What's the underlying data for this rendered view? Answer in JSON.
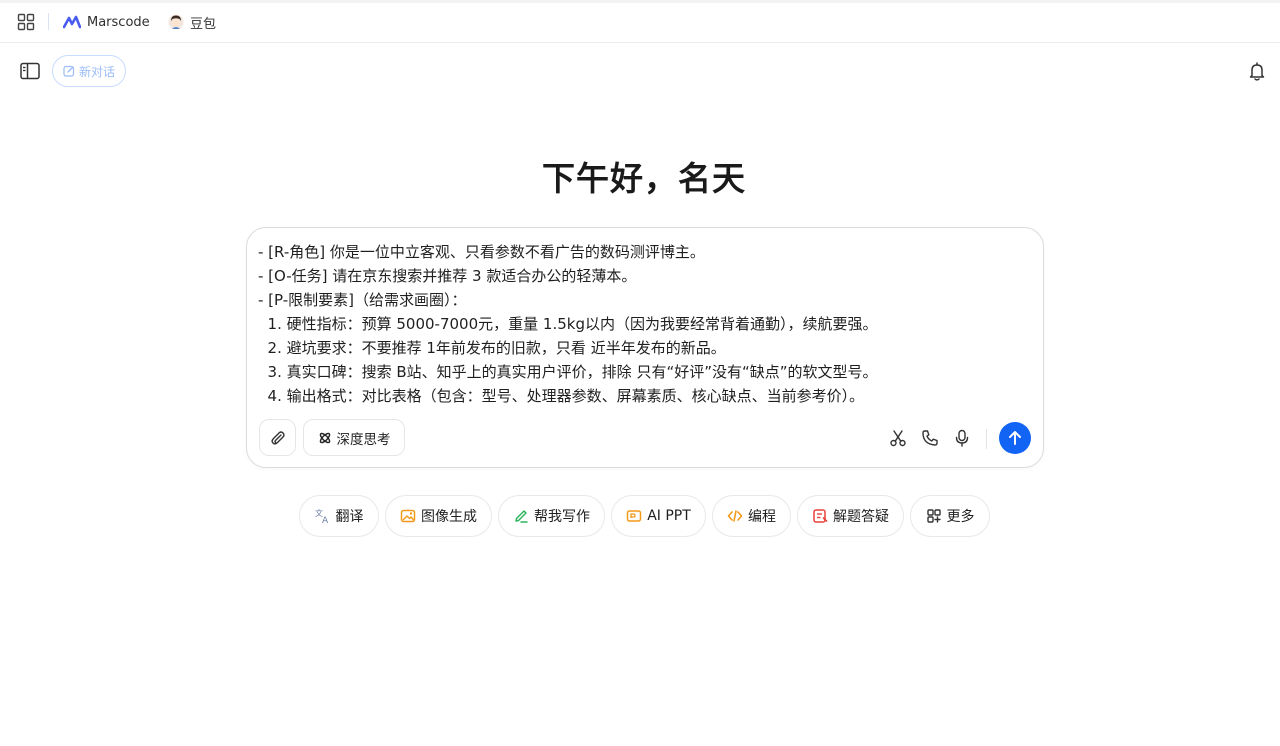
{
  "bookmarks": {
    "items": [
      {
        "label": "Marscode",
        "icon": "marscode-logo-icon"
      },
      {
        "label": "豆包",
        "icon": "doubao-avatar-icon"
      }
    ]
  },
  "topbar": {
    "new_chat_label": "新对话"
  },
  "greeting": "下午好，名天",
  "input": {
    "lines": [
      "- [R-角色] 你是一位中立客观、只看参数不看广告的数码测评博主。",
      "- [O-任务] 请在京东搜索并推荐 3 款适合办公的轻薄本。",
      "- [P-限制要素]（给需求画圈）：",
      "  1. 硬性指标：预算 5000-7000元，重量 1.5kg以内（因为我要经常背着通勤），续航要强。",
      "  2. 避坑要求：不要推荐 1年前发布的旧款，只看 近半年发布的新品。",
      "  3. 真实口碑：搜索 B站、知乎上的真实用户评价，排除 只有“好评”没有“缺点”的软文型号。",
      "  4. 输出格式：对比表格（包含：型号、处理器参数、屏幕素质、核心缺点、当前参考价）。"
    ],
    "deep_think_label": "深度思考",
    "send_color": "#1264f5"
  },
  "skills": [
    {
      "label": "翻译",
      "icon": "translate-icon",
      "color": "#6f7fa6"
    },
    {
      "label": "图像生成",
      "icon": "image-generate-icon",
      "color": "#f29a1a"
    },
    {
      "label": "帮我写作",
      "icon": "writing-icon",
      "color": "#2db55d"
    },
    {
      "label": "AI PPT",
      "icon": "ppt-icon",
      "color": "#f29a1a"
    },
    {
      "label": "编程",
      "icon": "code-icon",
      "color": "#f29a1a"
    },
    {
      "label": "解题答疑",
      "icon": "solve-icon",
      "color": "#e8443a"
    },
    {
      "label": "更多",
      "icon": "more-grid-icon",
      "color": "#333333"
    }
  ]
}
